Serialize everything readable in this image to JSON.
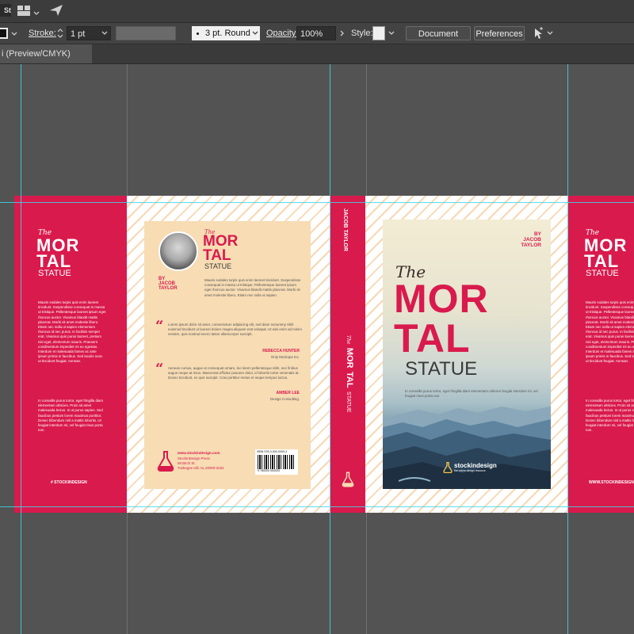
{
  "toolbar": {
    "app_badge": "St",
    "stroke_label": "Stroke:",
    "stroke_value": "1 pt",
    "brush_value": "3 pt. Round",
    "opacity_label": "Opacity:",
    "opacity_value": "100%",
    "style_label": "Style:",
    "document_setup": "Document Setup",
    "preferences": "Preferences"
  },
  "tab": {
    "label": "i (Preview/CMYK)"
  },
  "flap_left": {
    "title_the": "The",
    "title_mor": "MOR",
    "title_tal": "TAL",
    "title_statue": "STATUE",
    "para1": "Mauris sodales turpis quis enim laoreet tincidunt. Suspendisse consequat in massa ut tristique. Pellentesque laoreet ipsum eget rhoncus auctor. Vivamus blandit mattis placerat. Morbi sit amet molestie libero. Etiam nec nulla ut sapien elementum rhoncus id nec purus. In facilisis semper erat. Vivamus quis purus laoreet, pretium nisi eget, elementum mauris. Praesent condimentum imperdiet mi eu egestas. Interdum et malesuada fames ac ante ipsum primis in faucibus. Sed iaculis nunc ut tincidunt feugiat. Aenean.",
    "para2": "In convallis purus tortor, eget fringilla diam elementum ultricies. Proin sit amet malesuada lectus. In ut purus sapien. Sed faucibus pretium lorem maximus porttitor. Donec bibendum nisl a mattis lobortis. Ut feugiat interdum mi, vel feugiat risus porta non.",
    "hashtag": "# STOCKINDESIGN"
  },
  "back_cover": {
    "title_the": "The",
    "title_mor": "MOR",
    "title_tal": "TAL",
    "title_statue": "STATUE",
    "by": "BY",
    "author_first": "JACOB",
    "author_last": "TAYLOR",
    "about": "Mauris sodales turpis quis enim laoreet tincidunt. Suspendisse consequat in massa ut tristique. Pellentesque laoreet ipsum eget rhoncus auctor. Vivamus blandit mattis placerat. Morbi sit amet molestie libero. Etiam nec nulla ut sapien.",
    "quote1": "Lorem ipsum dolor sit amet, consectetuer adipiscing elit, sed diam nonummy nibh euismod tincidunt ut laoreet dolore magna aliquam erat volutpat. Ut wisi enim ad minim veniam, quis nostrud exerci tation ullamcorper suscipit.",
    "quote1_author": "REBECCA HUNTER",
    "quote1_org": "Only Mockups Inc.",
    "quote2": "Aenean cursus, augue at consequat ornare, leo lorem pellentesque nibh, nec finibus augue neque at risus. Maecenas efficitur posuere dolor, id lobortis tortor venenatis at. Donec tincidunt, ex quis suscipit. Cras porttitor metus et neque tempus luctus.",
    "quote2_author": "AMBER LEE",
    "quote2_org": "Design Consulting.",
    "publisher_url": "www.stockindesign.com",
    "publisher_name": "StockInDesign Press",
    "publisher_street": "Mt Birch St.",
    "publisher_city": "Tuskegee Hill, AL 20000-2254",
    "isbn": "ISBN 978-0-000-0000-3",
    "barcode_digits": "9 780000 000003"
  },
  "spine": {
    "author": "JACOB TAYLOR",
    "the": "The",
    "mor": "MOR",
    "tal": "TAL",
    "statue": "STATUE"
  },
  "front_cover": {
    "by": "BY",
    "author_first": "JACOB",
    "author_last": "TAYLOR",
    "title_the": "The",
    "title_mor": "MOR",
    "title_tal": "TAL",
    "title_statue": "STATUE",
    "tagline": "In convallis purus tortor, eget fringilla diam elementum ultricies feugiat interdum mi, vel feugiat risus porta non",
    "logo_text": "stockindesign",
    "logo_sub": "the online design resource"
  },
  "flap_right": {
    "title_the": "The",
    "title_mor": "MOR",
    "title_tal": "TAL",
    "title_statue": "STATUE",
    "para1": "Mauris sodales turpis quis enim laoreet tincidunt. Suspendisse consequat in massa ut tristique. Pellentesque laoreet ipsum eget rhoncus auctor. Vivamus blandit mattis placerat. Morbi sit amet molestie libero. Etiam nec nulla ut sapien elementum rhoncus id nec purus. In facilisis semper erat. Vivamus quis purus laoreet, pretium nisi eget, elementum mauris. Praesent condimentum imperdiet mi eu egestas. Interdum et malesuada fames ac ante ipsum primis in faucibus. Sed iaculis nunc ut tincidunt feugiat. Aenean.",
    "para2": "In convallis purus tortor, eget fringilla diam elementum ultricies. Proin sit amet malesuada lectus. In ut purus sapien. Sed faucibus pretium lorem maximus porttitor. Donec bibendum nisl a mattis lobortis. Ut feugiat interdum mi, vel feugiat risus porta non.",
    "hashtag": "WWW.STOCKINDESIGN"
  },
  "colors": {
    "accent": "#d91a4d",
    "peach": "#f7dcb4",
    "guide": "#3fd7e8"
  }
}
